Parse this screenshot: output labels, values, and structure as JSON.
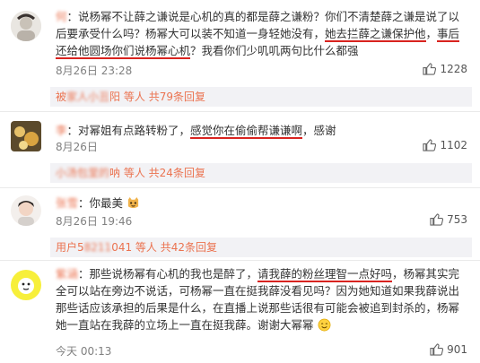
{
  "comments": [
    {
      "user": "何",
      "text_a": "：说杨幂不让薛之谦说是心机的真的都是薛之谦粉？你们不清楚薛之谦是说了以后要承受什么吗？杨幂大可以装不知道一身轻她没有，",
      "emph_1": "她去拦薛之谦保护他",
      "text_b": "，",
      "emph_2": "事后还给他圆场你们说杨幂心机",
      "text_c": "？我看你们少叽叽两句比什么都强",
      "time": "8月26日 23:28",
      "likes": "1228",
      "reply_user": "被",
      "reply_rest": "阳 等人",
      "reply_count": "共79条回复"
    },
    {
      "user": "",
      "text_a": "：对幂姐有点路转粉了，",
      "emph_1": "感觉你在偷偷帮谦谦啊",
      "text_b": "，感谢",
      "time": "8月26日",
      "likes": "1102",
      "reply_user": "",
      "reply_rest": "呐 等人",
      "reply_count": "共24条回复"
    },
    {
      "user": "",
      "text_a": "：你最美",
      "time": "8月26日 19:46",
      "likes": "753",
      "reply_user": "用户5",
      "reply_rest": "041 等人",
      "reply_count": "共42条回复"
    },
    {
      "user": "",
      "text_a": "：那些说杨幂有心机的我也是醉了，",
      "emph_1": "请我薛的粉丝理智一点好吗",
      "text_b": "，杨幂其实完全可以站在旁边不说话，可杨幂一直在挺我薛没看见吗？因为她知道如果我薛说出那些话应该承担的后果是什么，在直播上说那些话很有可能会被追到封杀的，杨幂她一直站在我薛的立场上一直在挺我薛。谢谢大幂幂",
      "time": "今天 00:13",
      "likes": "901"
    }
  ],
  "icons": {
    "like": "thumbs-up-icon",
    "smile": "smile-emoji-icon",
    "cat": "cat-face-emoji-icon"
  }
}
